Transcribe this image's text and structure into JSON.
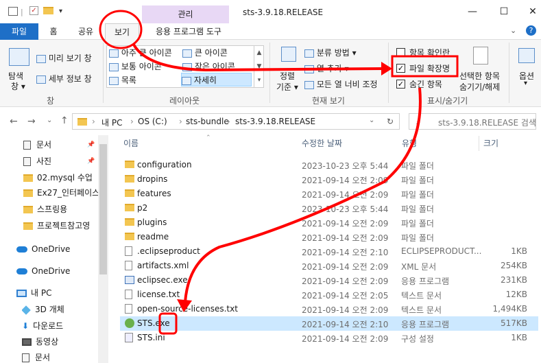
{
  "window": {
    "title": "sts-3.9.18.RELEASE",
    "manage_tab": "관리",
    "minimize": "—",
    "maximize": "☐",
    "close": "✕"
  },
  "tabs": [
    {
      "label": "파일"
    },
    {
      "label": "홈"
    },
    {
      "label": "공유"
    },
    {
      "label": "보기"
    },
    {
      "label": "응용 프로그램 도구"
    }
  ],
  "ribbon": {
    "pane": {
      "nav_pane_label": "탐색",
      "nav_pane_label2": "창 ▾",
      "preview": "미리 보기 창",
      "details": "세부 정보 창",
      "group": "창"
    },
    "layout": {
      "items": [
        "아주 큰 아이콘",
        "큰 아이콘",
        "보통 아이콘",
        "작은 아이콘",
        "목록",
        "자세히"
      ],
      "group": "레이아웃"
    },
    "current_view": {
      "sort_label": "정렬",
      "sort_label2": "기준 ▾",
      "group_by": "분류 방법 ▾",
      "add_columns": "열 추가 ▾",
      "fit_columns": "모든 열 너비 조정",
      "group": "현재 보기"
    },
    "show_hide": {
      "item_checkbox": "항목 확인란",
      "file_ext": "파일 확장명",
      "hidden_items": "숨긴 항목",
      "hide_selected": "선택한 항목",
      "hide_selected2": "숨기기/해제",
      "group": "표시/숨기기"
    },
    "options": "옵션"
  },
  "address": {
    "crumbs": [
      "내 PC",
      "OS (C:)",
      "sts-bundle",
      "sts-3.9.18.RELEASE"
    ],
    "search_placeholder": "sts-3.9.18.RELEASE 검색"
  },
  "nav": {
    "items": [
      {
        "label": "문서",
        "icon": "document-icon"
      },
      {
        "label": "사진",
        "icon": "picture-icon"
      },
      {
        "label": "02.mysql 수업",
        "icon": "folder-icon"
      },
      {
        "label": "Ex27_인터페이스",
        "icon": "folder-icon"
      },
      {
        "label": "스프링용",
        "icon": "folder-icon"
      },
      {
        "label": "프로젝트참고영",
        "icon": "folder-icon"
      },
      {
        "label": "OneDrive",
        "icon": "cloud-icon"
      },
      {
        "label": "OneDrive",
        "icon": "cloud-icon"
      },
      {
        "label": "내 PC",
        "icon": "pc-icon"
      },
      {
        "label": "3D 개체",
        "icon": "cube-icon"
      },
      {
        "label": "다운로드",
        "icon": "download-icon"
      },
      {
        "label": "동영상",
        "icon": "video-icon"
      },
      {
        "label": "문서",
        "icon": "document-icon"
      }
    ]
  },
  "columns": {
    "name": "이름",
    "date": "수정한 날짜",
    "type": "유형",
    "size": "크기"
  },
  "files": [
    {
      "name": "configuration",
      "date": "2023-10-23 오후 5:44",
      "type": "파일 폴더",
      "size": "",
      "kind": "folder"
    },
    {
      "name": "dropins",
      "date": "2021-09-14 오전 2:09",
      "type": "파일 폴더",
      "size": "",
      "kind": "folder"
    },
    {
      "name": "features",
      "date": "2021-09-14 오전 2:09",
      "type": "파일 폴더",
      "size": "",
      "kind": "folder"
    },
    {
      "name": "p2",
      "date": "2023-10-23 오후 5:44",
      "type": "파일 폴더",
      "size": "",
      "kind": "folder"
    },
    {
      "name": "plugins",
      "date": "2021-09-14 오전 2:09",
      "type": "파일 폴더",
      "size": "",
      "kind": "folder"
    },
    {
      "name": "readme",
      "date": "2021-09-14 오전 2:09",
      "type": "파일 폴더",
      "size": "",
      "kind": "folder"
    },
    {
      "name": ".eclipseproduct",
      "date": "2021-09-14 오전 2:10",
      "type": "ECLIPSEPRODUCT...",
      "size": "1KB",
      "kind": "file"
    },
    {
      "name": "artifacts.xml",
      "date": "2021-09-14 오전 2:09",
      "type": "XML 문서",
      "size": "254KB",
      "kind": "file"
    },
    {
      "name": "eclipsec.exe",
      "date": "2021-09-14 오전 2:09",
      "type": "응용 프로그램",
      "size": "231KB",
      "kind": "exe"
    },
    {
      "name": "license.txt",
      "date": "2021-09-14 오전 2:05",
      "type": "텍스트 문서",
      "size": "12KB",
      "kind": "file"
    },
    {
      "name": "open-source-licenses.txt",
      "date": "2021-09-14 오전 2:09",
      "type": "텍스트 문서",
      "size": "1,494KB",
      "kind": "file"
    },
    {
      "name": "STS.exe",
      "date": "2021-09-14 오전 2:10",
      "type": "응용 프로그램",
      "size": "517KB",
      "kind": "sts",
      "selected": true
    },
    {
      "name": "STS.ini",
      "date": "2021-09-14 오전 2:09",
      "type": "구성 설정",
      "size": "1KB",
      "kind": "ini"
    }
  ],
  "colors": {
    "accent": "#1e6fc7",
    "annotation": "#ff0000",
    "selection": "#cce8ff"
  }
}
